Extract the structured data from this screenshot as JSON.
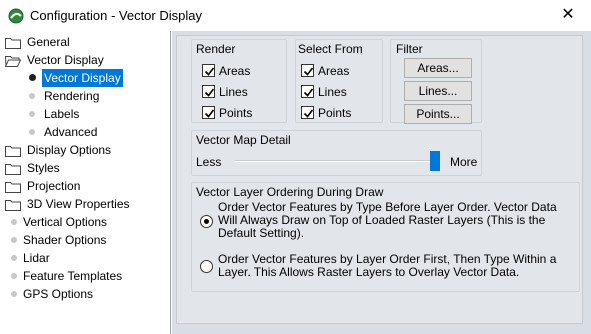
{
  "window": {
    "title": "Configuration - Vector Display",
    "close_glyph": "✕"
  },
  "tree": {
    "items": [
      {
        "label": "General",
        "icon": "folder-icon"
      },
      {
        "label": "Vector Display",
        "icon": "folder-open-icon"
      },
      {
        "label": "Vector Display",
        "selected": true
      },
      {
        "label": "Rendering"
      },
      {
        "label": "Labels"
      },
      {
        "label": "Advanced"
      },
      {
        "label": "Display Options",
        "icon": "folder-icon"
      },
      {
        "label": "Styles",
        "icon": "folder-icon"
      },
      {
        "label": "Projection",
        "icon": "folder-icon"
      },
      {
        "label": "3D View Properties",
        "icon": "folder-icon"
      },
      {
        "label": "Vertical Options"
      },
      {
        "label": "Shader Options"
      },
      {
        "label": "Lidar"
      },
      {
        "label": "Feature Templates"
      },
      {
        "label": "GPS Options"
      }
    ]
  },
  "render": {
    "label": "Render",
    "options": [
      {
        "label": "Areas",
        "checked": true
      },
      {
        "label": "Lines",
        "checked": true
      },
      {
        "label": "Points",
        "checked": true
      }
    ]
  },
  "select_from": {
    "label": "Select From",
    "options": [
      {
        "label": "Areas",
        "checked": true
      },
      {
        "label": "Lines",
        "checked": true
      },
      {
        "label": "Points",
        "checked": true
      }
    ]
  },
  "filter": {
    "label": "Filter",
    "buttons": [
      "Areas...",
      "Lines...",
      "Points..."
    ]
  },
  "detail": {
    "label": "Vector Map Detail",
    "min_label": "Less",
    "max_label": "More",
    "value_fraction": 1.0
  },
  "ordering": {
    "label": "Vector Layer Ordering During Draw",
    "options": [
      {
        "label": "Order Vector Features by Type Before Layer Order. Vector Data Will Always Draw on Top of Loaded Raster Layers (This is the Default Setting).",
        "selected": true
      },
      {
        "label": "Order Vector Features by Layer Order First, Then Type Within a Layer. This Allows Raster Layers to Overlay Vector Data.",
        "selected": false
      }
    ]
  },
  "colors": {
    "selection": "#0078d7",
    "slider_thumb": "#0078d7",
    "panel_bg": "#d9dde4"
  }
}
